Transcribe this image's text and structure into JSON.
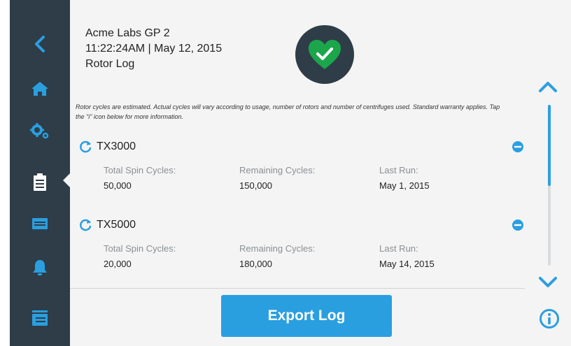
{
  "header": {
    "title": "Acme Labs GP 2",
    "datetime": "11:22:24AM | May 12, 2015",
    "subtitle": "Rotor Log"
  },
  "status": {
    "icon": "heart-check-icon",
    "color": "#1ca64c"
  },
  "disclaimer": "Rotor cycles are estimated. Actual cycles will vary according to usage, number of rotors and number of centrifuges used. Standard warranty applies. Tap the \"i\" icon below for more information.",
  "sidebar": {
    "items": [
      {
        "icon": "back-chevron-icon",
        "active": false
      },
      {
        "icon": "home-icon",
        "active": false
      },
      {
        "icon": "gears-icon",
        "active": false
      },
      {
        "icon": "clipboard-log-icon",
        "active": true
      },
      {
        "icon": "device-tray-icon",
        "active": false
      },
      {
        "icon": "bell-icon",
        "active": false
      },
      {
        "icon": "stacked-files-icon",
        "active": false
      }
    ]
  },
  "rotors": [
    {
      "name": "TX3000",
      "total_label": "Total Spin Cycles:",
      "total_value": "50,000",
      "remaining_label": "Remaining Cycles:",
      "remaining_value": "150,000",
      "last_label": "Last Run:",
      "last_value": "May 1, 2015"
    },
    {
      "name": "TX5000",
      "total_label": "Total Spin Cycles:",
      "total_value": "20,000",
      "remaining_label": "Remaining Cycles:",
      "remaining_value": "180,000",
      "last_label": "Last Run:",
      "last_value": "May 14, 2015"
    }
  ],
  "actions": {
    "export_label": "Export Log"
  },
  "colors": {
    "accent": "#2a9fe0",
    "sidebar": "#2e3d48",
    "panel": "#f4f4f4"
  }
}
